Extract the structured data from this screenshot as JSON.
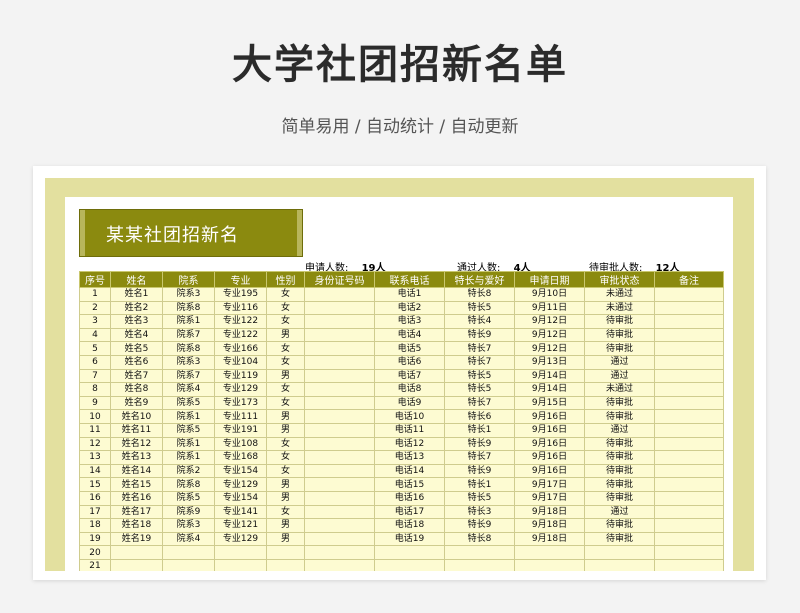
{
  "page": {
    "title": "大学社团招新名单",
    "subtitle": "简单易用 / 自动统计 / 自动更新"
  },
  "sheet": {
    "banner_title": "某某社团招新名",
    "stats": {
      "applicants_label": "申请人数:",
      "applicants_value": "19人",
      "passed_label": "通过人数:",
      "passed_value": "4人",
      "pending_label": "待审批人数:",
      "pending_value": "12人"
    },
    "columns": [
      "序号",
      "姓名",
      "院系",
      "专业",
      "性别",
      "身份证号码",
      "联系电话",
      "特长与爱好",
      "申请日期",
      "审批状态",
      "备注"
    ],
    "rows": [
      [
        "1",
        "姓名1",
        "院系3",
        "专业195",
        "女",
        "",
        "电话1",
        "特长8",
        "9月10日",
        "未通过",
        ""
      ],
      [
        "2",
        "姓名2",
        "院系8",
        "专业116",
        "女",
        "",
        "电话2",
        "特长5",
        "9月11日",
        "未通过",
        ""
      ],
      [
        "3",
        "姓名3",
        "院系1",
        "专业122",
        "女",
        "",
        "电话3",
        "特长4",
        "9月12日",
        "待审批",
        ""
      ],
      [
        "4",
        "姓名4",
        "院系7",
        "专业122",
        "男",
        "",
        "电话4",
        "特长9",
        "9月12日",
        "待审批",
        ""
      ],
      [
        "5",
        "姓名5",
        "院系8",
        "专业166",
        "女",
        "",
        "电话5",
        "特长7",
        "9月12日",
        "待审批",
        ""
      ],
      [
        "6",
        "姓名6",
        "院系3",
        "专业104",
        "女",
        "",
        "电话6",
        "特长7",
        "9月13日",
        "通过",
        ""
      ],
      [
        "7",
        "姓名7",
        "院系7",
        "专业119",
        "男",
        "",
        "电话7",
        "特长5",
        "9月14日",
        "通过",
        ""
      ],
      [
        "8",
        "姓名8",
        "院系4",
        "专业129",
        "女",
        "",
        "电话8",
        "特长5",
        "9月14日",
        "未通过",
        ""
      ],
      [
        "9",
        "姓名9",
        "院系5",
        "专业173",
        "女",
        "",
        "电话9",
        "特长7",
        "9月15日",
        "待审批",
        ""
      ],
      [
        "10",
        "姓名10",
        "院系1",
        "专业111",
        "男",
        "",
        "电话10",
        "特长6",
        "9月16日",
        "待审批",
        ""
      ],
      [
        "11",
        "姓名11",
        "院系5",
        "专业191",
        "男",
        "",
        "电话11",
        "特长1",
        "9月16日",
        "通过",
        ""
      ],
      [
        "12",
        "姓名12",
        "院系1",
        "专业108",
        "女",
        "",
        "电话12",
        "特长9",
        "9月16日",
        "待审批",
        ""
      ],
      [
        "13",
        "姓名13",
        "院系1",
        "专业168",
        "女",
        "",
        "电话13",
        "特长7",
        "9月16日",
        "待审批",
        ""
      ],
      [
        "14",
        "姓名14",
        "院系2",
        "专业154",
        "女",
        "",
        "电话14",
        "特长9",
        "9月16日",
        "待审批",
        ""
      ],
      [
        "15",
        "姓名15",
        "院系8",
        "专业129",
        "男",
        "",
        "电话15",
        "特长1",
        "9月17日",
        "待审批",
        ""
      ],
      [
        "16",
        "姓名16",
        "院系5",
        "专业154",
        "男",
        "",
        "电话16",
        "特长5",
        "9月17日",
        "待审批",
        ""
      ],
      [
        "17",
        "姓名17",
        "院系9",
        "专业141",
        "女",
        "",
        "电话17",
        "特长3",
        "9月18日",
        "通过",
        ""
      ],
      [
        "18",
        "姓名18",
        "院系3",
        "专业121",
        "男",
        "",
        "电话18",
        "特长9",
        "9月18日",
        "待审批",
        ""
      ],
      [
        "19",
        "姓名19",
        "院系4",
        "专业129",
        "男",
        "",
        "电话19",
        "特长8",
        "9月18日",
        "待审批",
        ""
      ],
      [
        "20",
        "",
        "",
        "",
        "",
        "",
        "",
        "",
        "",
        "",
        ""
      ],
      [
        "21",
        "",
        "",
        "",
        "",
        "",
        "",
        "",
        "",
        "",
        ""
      ]
    ]
  }
}
